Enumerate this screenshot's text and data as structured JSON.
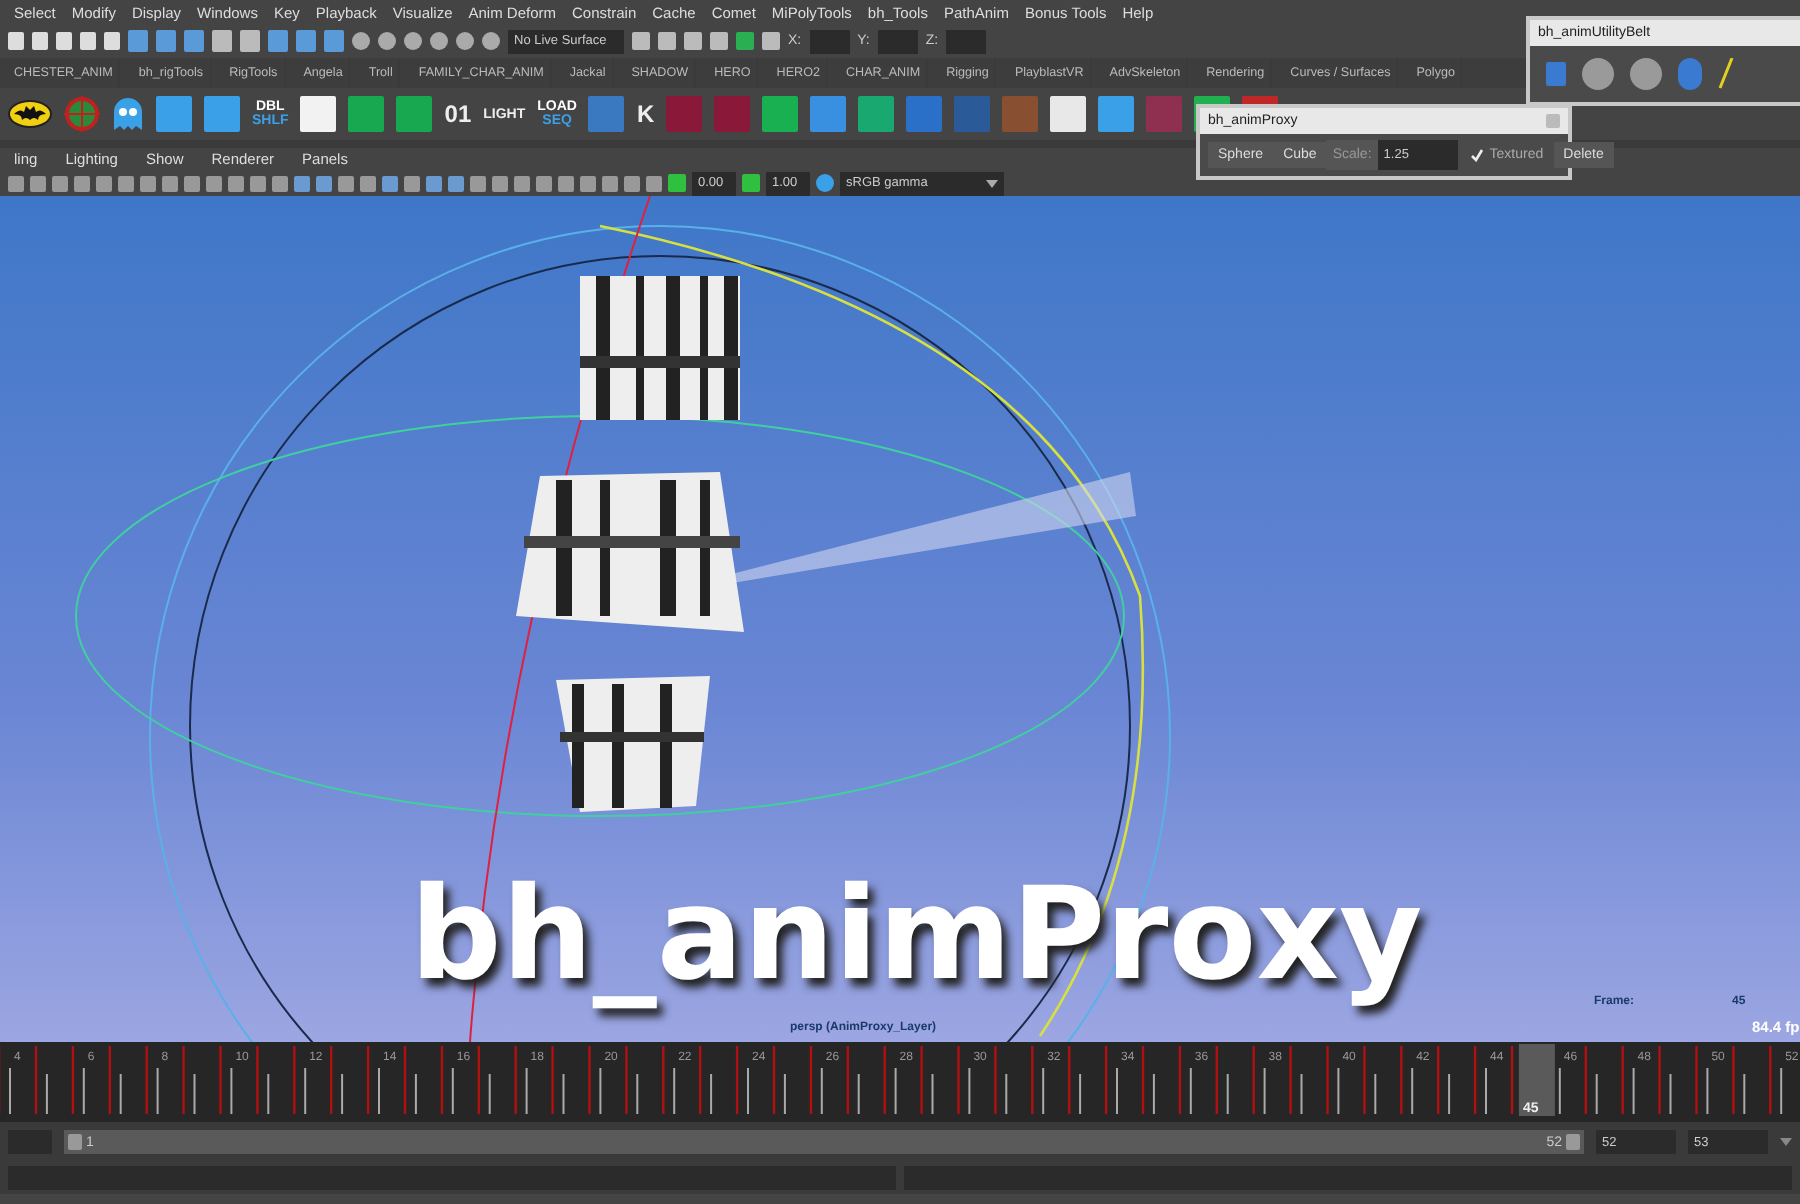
{
  "menu_bar": [
    "Select",
    "Modify",
    "Display",
    "Windows",
    "Key",
    "Playback",
    "Visualize",
    "Anim Deform",
    "Constrain",
    "Cache",
    "Comet",
    "MiPolyTools",
    "bh_Tools",
    "PathAnim",
    "Bonus Tools",
    "Help"
  ],
  "status_line": {
    "live_surface": "No Live Surface",
    "coords": [
      "X:",
      "Y:",
      "Z:"
    ]
  },
  "shelf_tabs": [
    "CHESTER_ANIM",
    "bh_rigTools",
    "RigTools",
    "Angela",
    "Troll",
    "FAMILY_CHAR_ANIM",
    "Jackal",
    "SHADOW",
    "HERO",
    "HERO2",
    "CHAR_ANIM",
    "Rigging",
    "PlayblastVR",
    "AdvSkeleton",
    "Rendering",
    "Curves / Surfaces",
    "Polygo"
  ],
  "shelf": [
    {
      "kind": "logo"
    },
    {
      "kind": "target"
    },
    {
      "kind": "ghost"
    },
    {
      "kind": "tile",
      "color": "#3aa0e8"
    },
    {
      "kind": "tile",
      "color": "#3aa0e8"
    },
    {
      "kind": "text",
      "lines": [
        "DBL",
        "SHLF"
      ]
    },
    {
      "kind": "tile",
      "color": "#f2f2f2"
    },
    {
      "kind": "tile",
      "color": "#18a850"
    },
    {
      "kind": "tile",
      "color": "#18a850"
    },
    {
      "kind": "text",
      "lines": [
        "01"
      ]
    },
    {
      "kind": "text",
      "lines": [
        "LIGHT"
      ]
    },
    {
      "kind": "text",
      "lines": [
        "LOAD",
        "SEQ"
      ]
    },
    {
      "kind": "tile",
      "color": "#3a78c0"
    },
    {
      "kind": "text",
      "lines": [
        "K"
      ]
    },
    {
      "kind": "tile",
      "color": "#8a1838"
    },
    {
      "kind": "tile",
      "color": "#8a1838"
    },
    {
      "kind": "tile",
      "color": "#18b050"
    },
    {
      "kind": "tile",
      "color": "#3a90e0"
    },
    {
      "kind": "tile",
      "color": "#18a870"
    },
    {
      "kind": "tile",
      "color": "#2a70c8"
    },
    {
      "kind": "tile",
      "color": "#2a5a98"
    },
    {
      "kind": "tile",
      "color": "#885030"
    },
    {
      "kind": "tile",
      "color": "#e8e8e8"
    },
    {
      "kind": "tile",
      "color": "#3aa0e8"
    },
    {
      "kind": "tile",
      "color": "#903050"
    },
    {
      "kind": "tile",
      "color": "#20b050"
    },
    {
      "kind": "tile",
      "color": "#c02828"
    }
  ],
  "panel_menu": [
    "ling",
    "Lighting",
    "Show",
    "Renderer",
    "Panels"
  ],
  "viewport_toolbar": {
    "exposure": "0.00",
    "gamma": "1.00",
    "color_space": "sRGB gamma"
  },
  "viewport": {
    "camera_label": "persp (AnimProxy_Layer)",
    "hud": {
      "frame_label": "Frame:",
      "frame_value": "45",
      "fps": "84.4 fp"
    },
    "overlay_title": "bh_animProxy"
  },
  "utility_belt": {
    "title": "bh_animUtilityBelt"
  },
  "anim_proxy": {
    "title": "bh_animProxy",
    "buttons": [
      "Sphere",
      "Cube"
    ],
    "scale_label": "Scale:",
    "scale_value": "1.25",
    "textured_label": "Textured",
    "textured_checked": true,
    "delete_label": "Delete"
  },
  "timeline": {
    "labels": [
      "4",
      "6",
      "8",
      "10",
      "12",
      "14",
      "16",
      "18",
      "20",
      "22",
      "24",
      "26",
      "28",
      "30",
      "32",
      "34",
      "36",
      "38",
      "40",
      "42",
      "44",
      "46",
      "48",
      "50",
      "52"
    ],
    "current_frame": "45"
  },
  "range_slider": {
    "level": 1,
    "start": "1",
    "end": "52",
    "end_field": "52",
    "max_field": "53"
  }
}
